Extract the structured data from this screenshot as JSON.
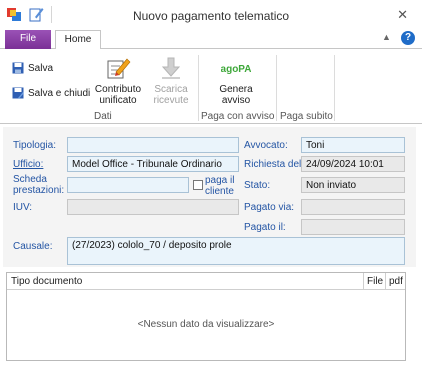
{
  "window": {
    "title": "Nuovo pagamento telematico",
    "close_glyph": "✕"
  },
  "ribbon_tabs": {
    "file": "File",
    "home": "Home"
  },
  "ribbon": {
    "salva": "Salva",
    "salva_e_chiudi": "Salva e chiudi",
    "contributo_line1": "Contributo",
    "contributo_line2": "unificato",
    "scarica_line1": "Scarica",
    "scarica_line2": "ricevute",
    "genera_line1": "Genera",
    "genera_line2": "avviso",
    "group_dati": "Dati",
    "group_paga_con_avviso": "Paga con avviso",
    "group_paga_subito": "Paga subito",
    "pagopa_logo_text": "agoPA"
  },
  "form": {
    "tipologia_label": "Tipologia:",
    "tipologia_value": "",
    "ufficio_label": "Ufficio:",
    "ufficio_value": "Model Office - Tribunale Ordinario",
    "scheda_label_line1": "Scheda",
    "scheda_label_line2": "prestazioni:",
    "scheda_value": "",
    "paga_il_cliente_line1": "paga il",
    "paga_il_cliente_line2": "cliente",
    "paga_il_cliente_checked": false,
    "iuv_label": "IUV:",
    "iuv_value": "",
    "avvocato_label": "Avvocato:",
    "avvocato_value": "Toni",
    "richiesta_label": "Richiesta del:",
    "richiesta_value": "24/09/2024 10:01",
    "stato_label": "Stato:",
    "stato_value": "Non inviato",
    "pagato_via_label": "Pagato via:",
    "pagato_via_value": "",
    "pagato_il_label": "Pagato il:",
    "pagato_il_value": "",
    "causale_label": "Causale:",
    "causale_value": "(27/2023) cololo_70 / deposito prole"
  },
  "grid": {
    "col_tipo_documento": "Tipo documento",
    "col_file": "File",
    "col_pdf": "pdf",
    "empty_message": "<Nessun dato da visualizzare>"
  },
  "colors": {
    "file_tab": "#7b3096",
    "label_blue": "#2455a4",
    "field_bg": "#eaf4fb",
    "readonly_bg": "#e9e9e9"
  }
}
